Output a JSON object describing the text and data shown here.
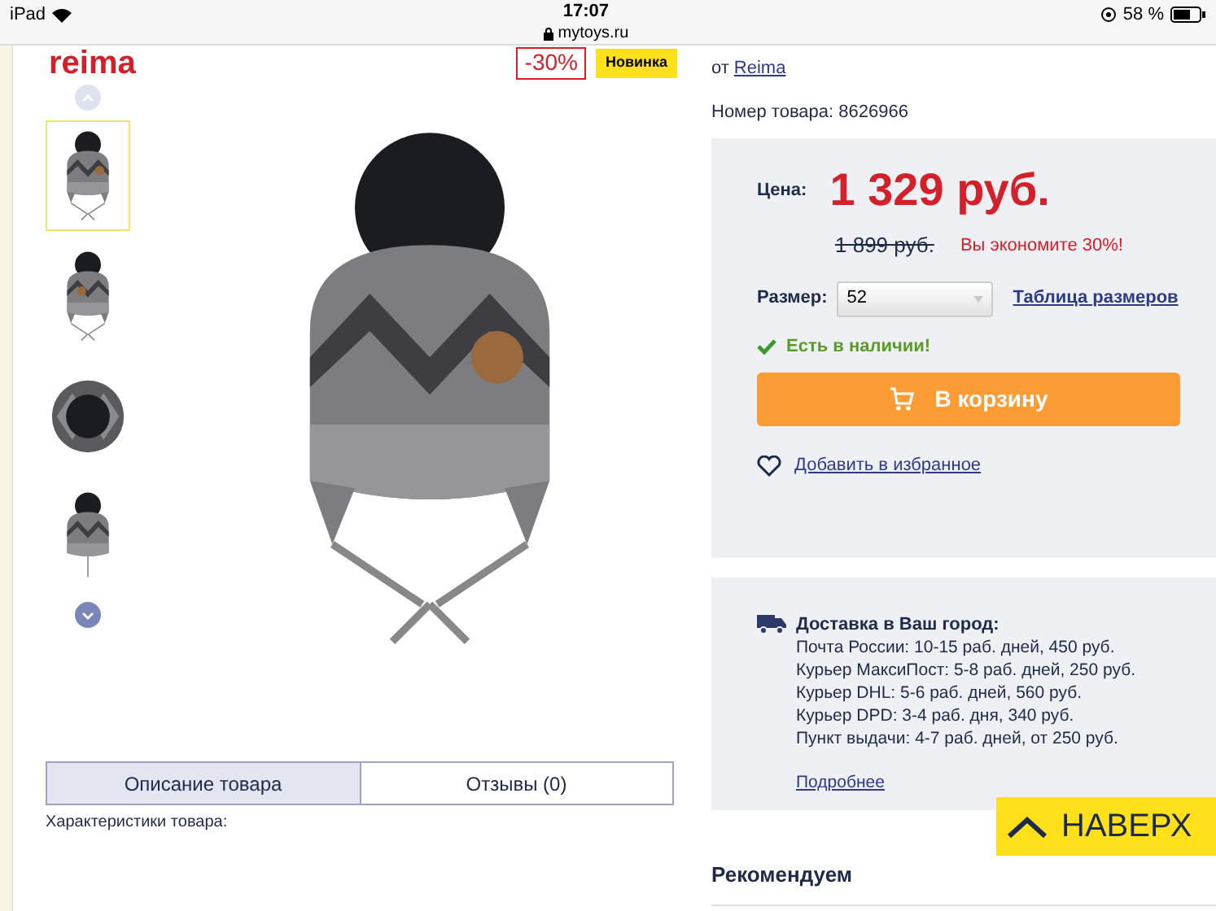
{
  "status_bar": {
    "device": "iPad",
    "time": "17:07",
    "url": "mytoys.ru",
    "battery": "58 %"
  },
  "logo": "reima",
  "badges": [
    {
      "kind": "discount",
      "text": "-30%"
    },
    {
      "kind": "new",
      "text": "Новинка"
    }
  ],
  "brand": {
    "prefix": "от",
    "link": "Reima"
  },
  "article": "Номер товара: 8626966",
  "thumbnails": [
    {
      "kind": "front",
      "selected": true
    },
    {
      "kind": "side",
      "selected": false
    },
    {
      "kind": "top",
      "selected": false
    },
    {
      "kind": "back",
      "selected": false
    }
  ],
  "price": {
    "label": "Цена:",
    "current": "1 329 руб.",
    "old": "1 899 руб.",
    "saving": "Вы экономите 30%!"
  },
  "size": {
    "label": "Размер:",
    "value": "52",
    "table_link": "Таблица размеров"
  },
  "stock": {
    "in_stock": true,
    "text": "Есть в наличии!"
  },
  "cart_button": "В корзину",
  "wishlist": "Добавить в избранное",
  "delivery": {
    "title": "Доставка в Ваш город:",
    "lines": [
      "Почта России: 10-15 раб. дней, 450 руб.",
      "Курьер МаксиПост: 5-8 раб. дней, 250 руб.",
      "Курьер DHL: 5-6 раб. дней, 560 руб.",
      "Курьер DPD: 3-4 раб. дня, 340 руб.",
      "Пункт выдачи: 4-7 раб. дней, от 250 руб."
    ],
    "more": "Подробнее"
  },
  "to_top": "НАВЕРХ",
  "recommend": "Рекомендуем",
  "tabs": [
    {
      "label": "Описание товара",
      "selected": true
    },
    {
      "label": "Отзывы (0)",
      "selected": false
    }
  ],
  "characteristics": "Характеристики товара:"
}
